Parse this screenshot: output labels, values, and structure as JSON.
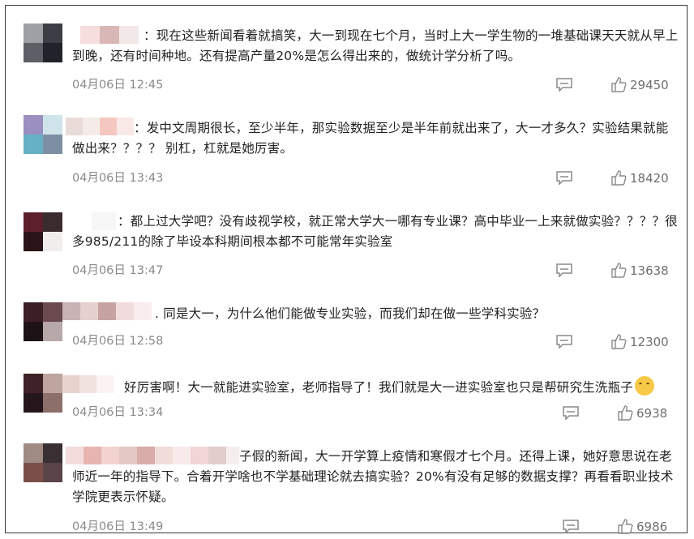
{
  "comments": [
    {
      "text": "：现在这些新闻看着就搞笑，大一到现在七个月，当时上大一学生物的一堆基础课天天就从早上到晚，还有时间种地。还有提高产量20%是怎么得出来的，做统计学分析了吗。",
      "time": "04月06日 12:45",
      "likes": "29450"
    },
    {
      "text": "：发中文周期很长，至少半年，那实验数据至少是半年前就出来了，大一才多久？实验结果就能做出来？？？？ 别杠，杠就是她厉害。",
      "time": "04月06日 13:43",
      "likes": "18420"
    },
    {
      "text": "：都上过大学吧？没有歧视学校，就正常大学大一哪有专业课？高中毕业一上来就做实验？？？？很多985/211的除了毕设本科期间根本都不可能常年实验室",
      "time": "04月06日 13:47",
      "likes": "13638"
    },
    {
      "text": ". 同是大一，为什么他们能做专业实验，而我们却在做一些学科实验？",
      "time": "04月06日 12:58",
      "likes": "12300"
    },
    {
      "text": "好厉害啊！大一就能进实验室，老师指导了！我们就是大一进实验室也只是帮研究生洗瓶子",
      "time": "04月06日 13:34",
      "likes": "6938"
    },
    {
      "text": "子假的新闻，大一开学算上疫情和寒假才七个月。还得上课，她好意思说在老师近一年的指导下。合着开学啥也不学基础理论就去搞实验？20%有没有足够的数据支撑？再看看职业技术学院更表示怀疑。",
      "time": "04月06日 13:49",
      "likes": "6986"
    }
  ],
  "icons": {
    "reply": "comment-reply-icon",
    "like": "thumbs-up-icon"
  },
  "colors": {
    "text": "#222222",
    "meta": "#8a8a8a",
    "border": "#3a3a3a"
  }
}
